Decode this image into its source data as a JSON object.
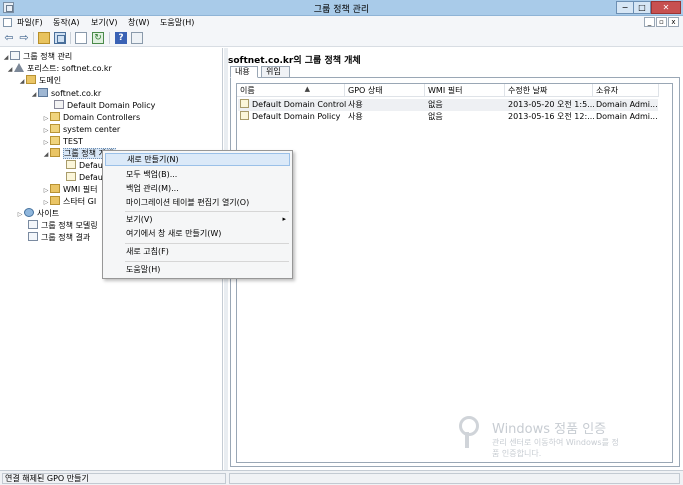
{
  "window": {
    "title": "그룹 정책 관리",
    "min_label": "−",
    "max_label": "□",
    "close_label": "✕"
  },
  "menubar": {
    "items": [
      "파일(F)",
      "동작(A)",
      "보기(V)",
      "창(W)",
      "도움말(H)"
    ],
    "mdi": [
      "_",
      "▫",
      "x"
    ]
  },
  "toolbar": {
    "back_glyph": "⇦",
    "forward_glyph": "⇨",
    "refresh_glyph": "↻",
    "help_glyph": "?"
  },
  "tree": {
    "root": "그룹 정책 관리",
    "forest": "포리스트: softnet.co.kr",
    "domains": "도메인",
    "domain": "softnet.co.kr",
    "items": [
      "Default Domain Policy",
      "Domain Controllers",
      "system center",
      "TEST"
    ],
    "gpo_container": "그룹 정책 개체",
    "gpo_children": [
      "Defaul",
      "Defaul"
    ],
    "wmi": "WMI 필터",
    "starter": "스타터 GI",
    "sites": "사이트",
    "modeling": "그룹 정책 모델링",
    "results": "그룹 정책 결과"
  },
  "rightpane": {
    "title": "softnet.co.kr의 그룹 정책 개체",
    "tabs": [
      "내용",
      "위임"
    ],
    "columns": [
      "이름",
      "GPO 상태",
      "WMI 필터",
      "수정한 날짜",
      "소유자"
    ],
    "rows": [
      [
        "Default Domain Control...",
        "사용",
        "없음",
        "2013-05-20 오전 1:5...",
        "Domain Admi..."
      ],
      [
        "Default Domain Policy",
        "사용",
        "없음",
        "2013-05-16 오전 12:...",
        "Domain Admi..."
      ]
    ]
  },
  "context_menu": {
    "items": [
      "새로 만들기(N)",
      "모두 백업(B)...",
      "백업 관리(M)...",
      "마이그레이션 테이블 편집기 열기(O)",
      "보기(V)",
      "여기에서 창 새로 만들기(W)",
      "새로 고침(F)",
      "도움말(H)"
    ],
    "submenu_arrow": "▸"
  },
  "watermark": {
    "line1": "Windows 정품 인증",
    "line2": "관리 센터로 이동하여 Windows를 정",
    "line3": "품 인증합니다."
  },
  "status": {
    "text": "연결 해제된 GPO 만들기"
  }
}
